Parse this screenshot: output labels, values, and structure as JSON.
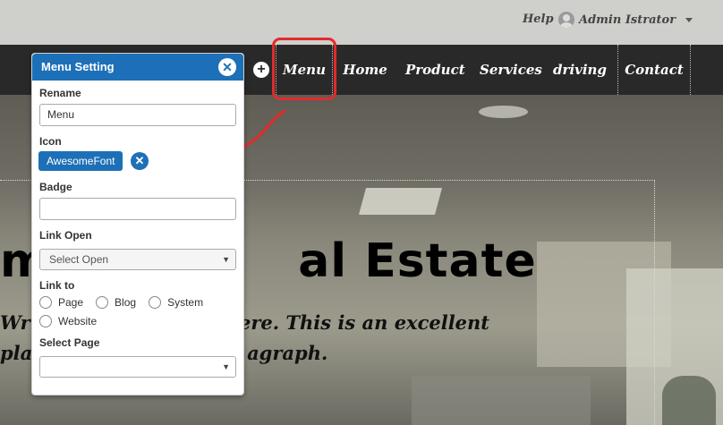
{
  "topbar": {
    "help": "Help",
    "user_name": "Admin Istrator"
  },
  "navbar": {
    "items": [
      "Menu",
      "Home",
      "Product",
      "Services",
      "driving",
      "Contact"
    ],
    "add_symbol": "+"
  },
  "hero": {
    "title_left": "m",
    "title_right": "al Estate",
    "subtitle_1_left": "Wr",
    "subtitle_1_right": "here. This is an excellent",
    "subtitle_2_left": "plac",
    "subtitle_2_right": "agraph."
  },
  "menu_setting": {
    "title": "Menu Setting",
    "close_symbol": "✕",
    "rename_label": "Rename",
    "rename_value": "Menu",
    "icon_label": "Icon",
    "icon_value": "AwesomeFont",
    "remove_symbol": "✕",
    "badge_label": "Badge",
    "badge_value": "",
    "link_open_label": "Link Open",
    "link_open_value": "Select Open",
    "link_to_label": "Link to",
    "link_to_options": [
      "Page",
      "Blog",
      "System",
      "Website"
    ],
    "select_page_label": "Select Page",
    "select_page_value": ""
  },
  "colors": {
    "accent": "#1d70b7",
    "annotation": "#e12b2b",
    "navbar": "#292929"
  }
}
